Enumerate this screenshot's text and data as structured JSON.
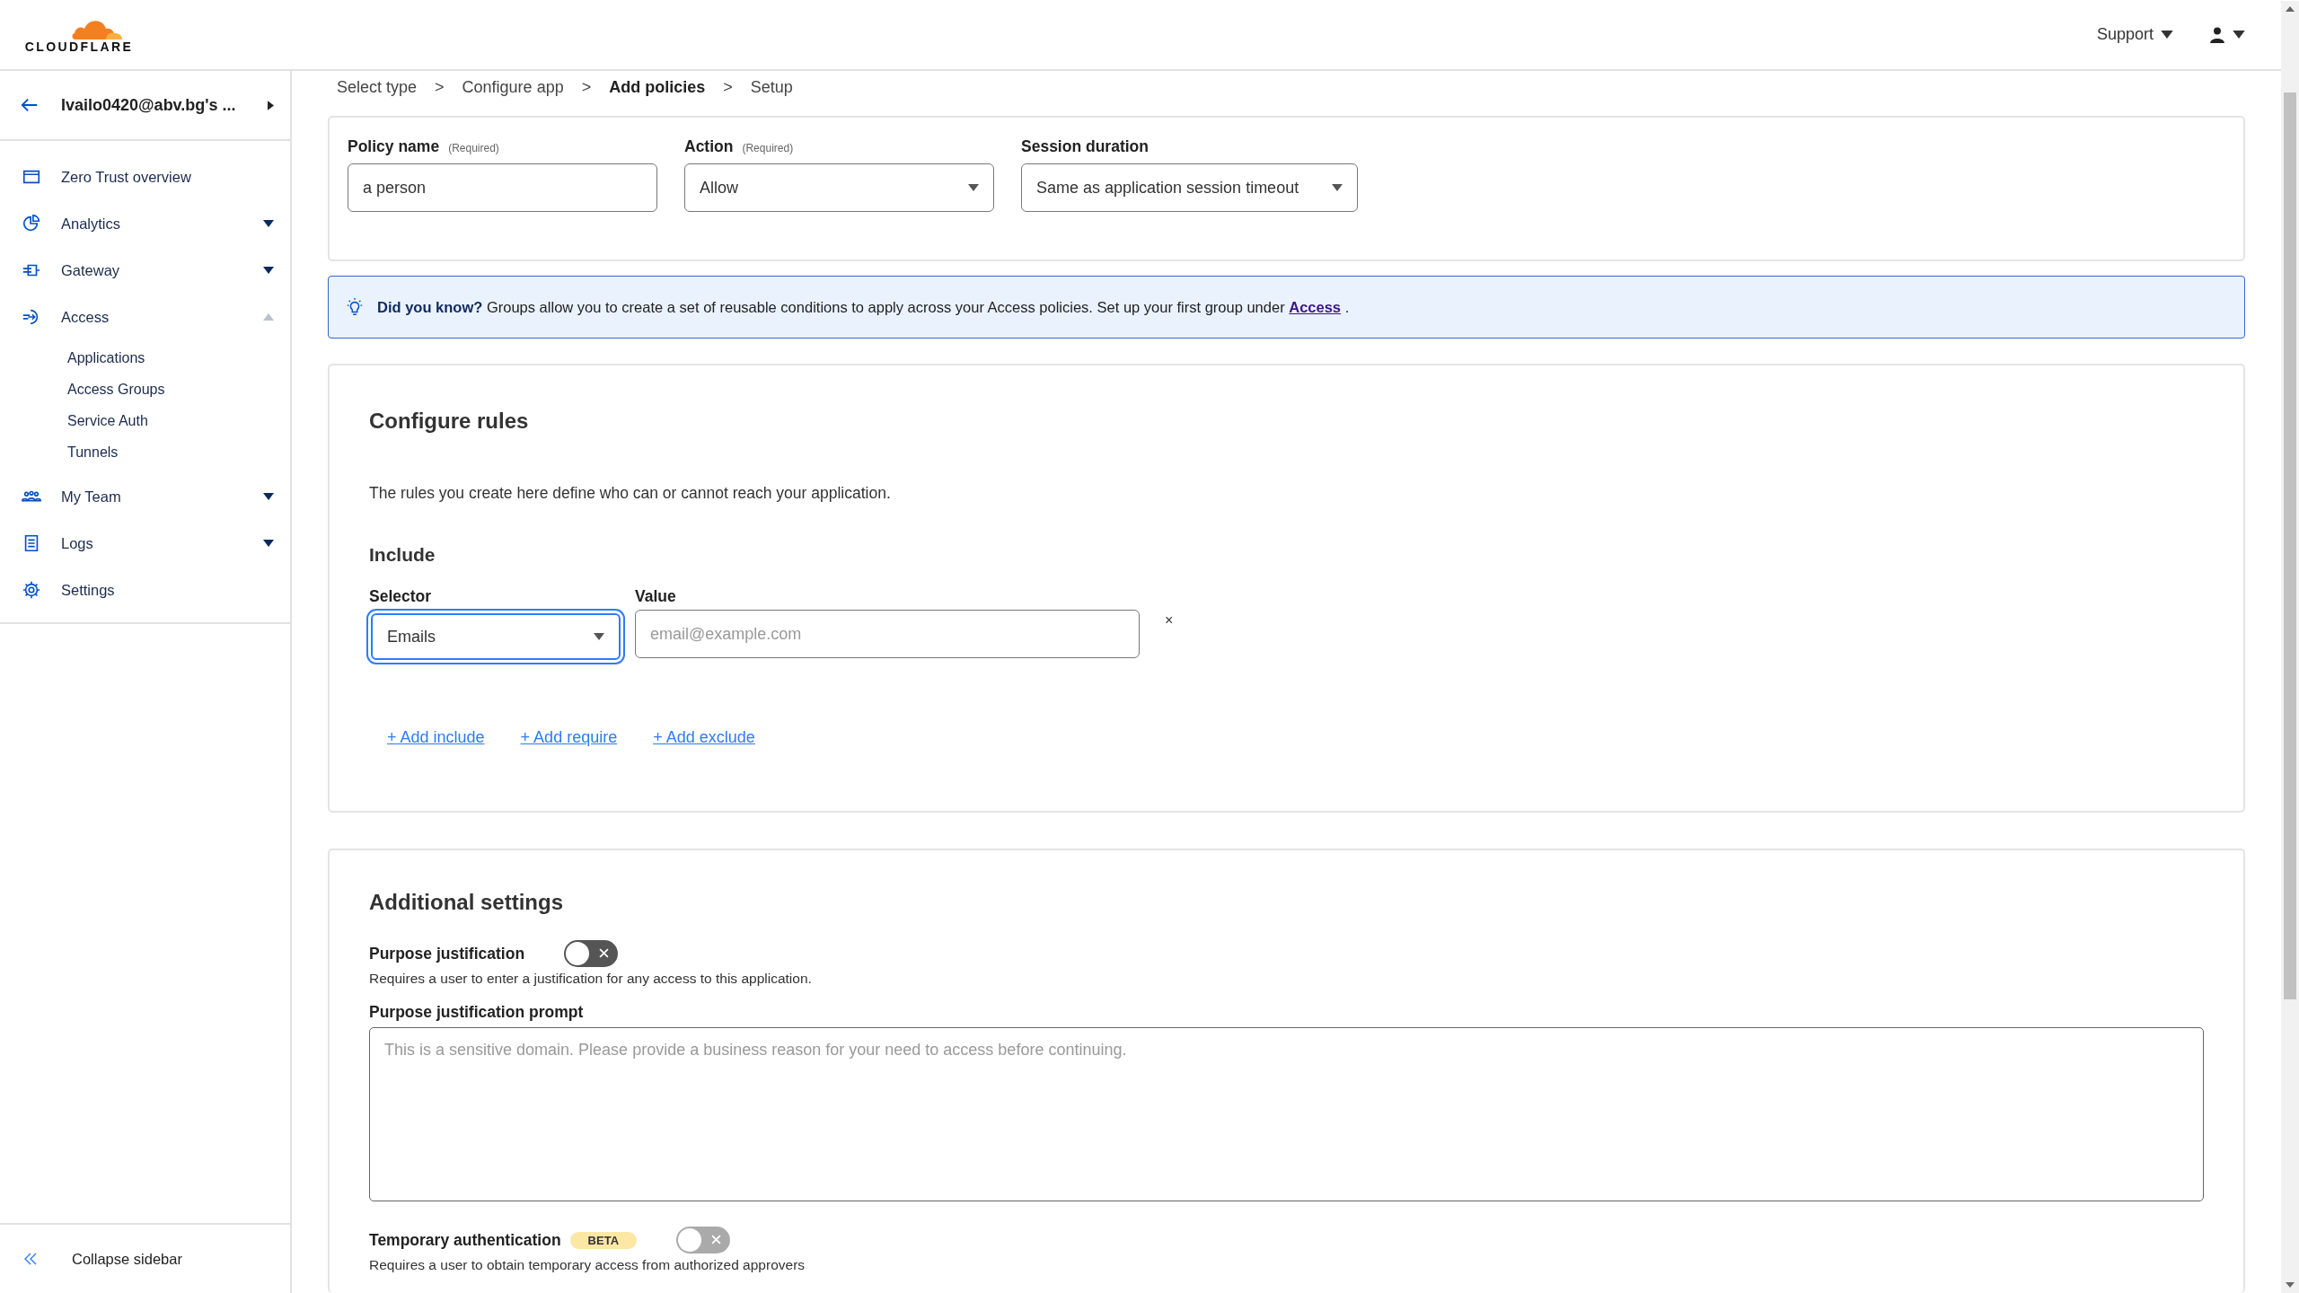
{
  "header": {
    "logo_text": "CLOUDFLARE",
    "support": "Support"
  },
  "sidebar": {
    "account": "Ivailo0420@abv.bg's ...",
    "items": [
      {
        "label": "Zero Trust overview"
      },
      {
        "label": "Analytics",
        "expanded": false
      },
      {
        "label": "Gateway",
        "expanded": false
      },
      {
        "label": "Access",
        "expanded": true,
        "children": [
          {
            "label": "Applications"
          },
          {
            "label": "Access Groups"
          },
          {
            "label": "Service Auth"
          },
          {
            "label": "Tunnels"
          }
        ]
      },
      {
        "label": "My Team",
        "expanded": false
      },
      {
        "label": "Logs",
        "expanded": false
      },
      {
        "label": "Settings"
      }
    ],
    "collapse": "Collapse sidebar"
  },
  "breadcrumb": {
    "steps": [
      {
        "label": "Select type",
        "selected": false
      },
      {
        "label": "Configure app",
        "selected": false
      },
      {
        "label": "Add policies",
        "selected": true
      },
      {
        "label": "Setup",
        "selected": false
      }
    ],
    "separators": [
      ">",
      ">",
      ">"
    ]
  },
  "policy": {
    "fields": [
      {
        "label": "Policy name",
        "required": "(Required)",
        "kind": "input",
        "value": "a person"
      },
      {
        "label": "Action",
        "required": "(Required)",
        "kind": "select",
        "value": "Allow"
      },
      {
        "label": "Session duration",
        "kind": "select",
        "value": "Same as application session timeout"
      }
    ]
  },
  "tip": {
    "text": "**Did you know?** Groups allow you to create a set of reusable conditions to apply across your Access policies. Set up your first group under",
    "link": "Access",
    "tail": "."
  },
  "rules": {
    "title": "Configure rules",
    "description": "The rules you create here define who can or cannot reach your application.",
    "include_title": "Include",
    "rows": [
      {
        "selector_label": "Selector",
        "selector": "Emails",
        "focused": true,
        "value_label": "Value",
        "value_placeholder": "email@example.com",
        "remove": "×"
      }
    ],
    "actions": [
      "+ Add include",
      "+ Add require",
      "+ Add exclude"
    ]
  },
  "additional": {
    "title": "Additional settings",
    "settings": [
      {
        "kind": "toggle",
        "label": "Purpose justification",
        "on": false,
        "disabled": false,
        "description": "Requires a user to enter a justification for any access to this application."
      },
      {
        "kind": "textarea",
        "label": "Purpose justification prompt",
        "placeholder": "This is a sensitive domain. Please provide a business reason for your need to access before continuing."
      },
      {
        "kind": "toggle",
        "label": "Temporary authentication",
        "badge": "BETA",
        "on": false,
        "disabled": true,
        "description": "Requires a user to obtain temporary access from authorized approvers"
      }
    ]
  }
}
